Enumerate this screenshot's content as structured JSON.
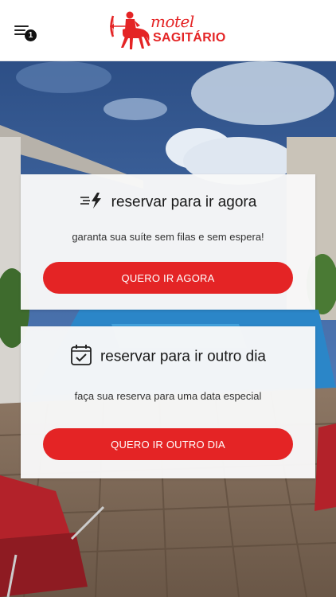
{
  "header": {
    "menu_badge": "1",
    "logo_script": "motel",
    "logo_brand": "SAGITÁRIO"
  },
  "cards": [
    {
      "icon": "lightning-speed-icon",
      "title": "reservar para ir agora",
      "subtitle": "garanta sua suíte sem filas e sem espera!",
      "button": "QUERO IR AGORA"
    },
    {
      "icon": "calendar-check-icon",
      "title": "reservar para ir outro dia",
      "subtitle": "faça sua reserva para uma data especial",
      "button": "QUERO IR OUTRO DIA"
    }
  ],
  "colors": {
    "accent": "#e42425",
    "text": "#1a1a1a"
  }
}
